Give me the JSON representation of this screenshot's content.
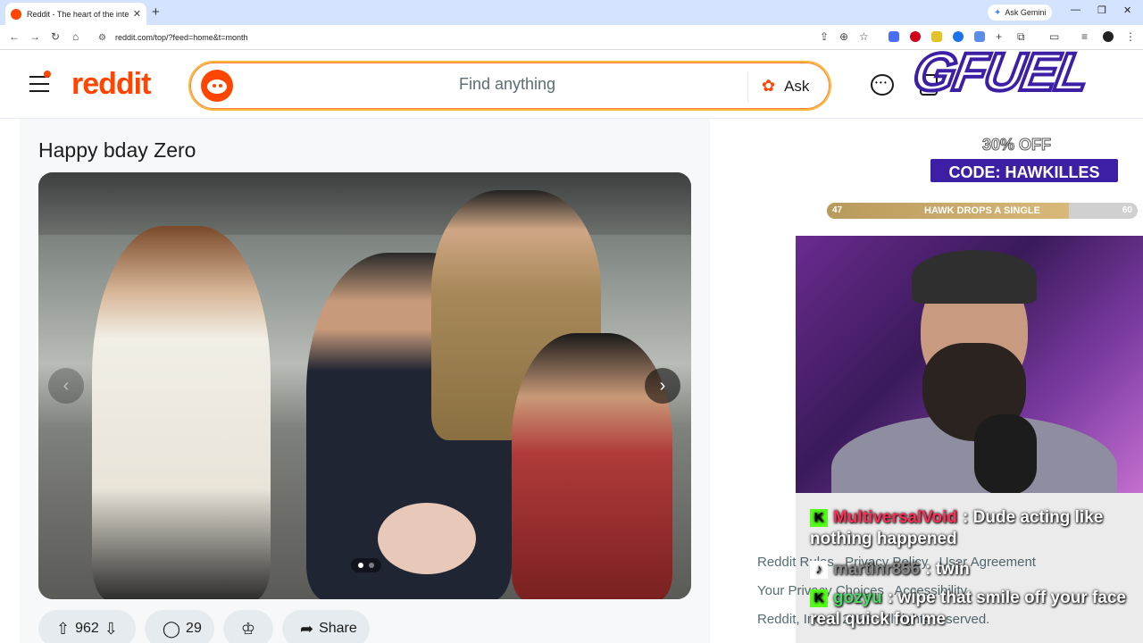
{
  "browser": {
    "tab_title": "Reddit - The heart of the internet",
    "new_tab": "+",
    "gemini_label": "Ask Gemini",
    "url": "reddit.com/top/?feed=home&t=month"
  },
  "header": {
    "logo": "reddit",
    "search_placeholder": "Find anything",
    "ask_label": "Ask"
  },
  "post": {
    "title": "Happy bday Zero",
    "upvotes": "962",
    "comments": "29",
    "share_label": "Share",
    "carousel_pages": 2,
    "carousel_current": 1
  },
  "footer": {
    "links": [
      "Reddit Rules",
      "Privacy Policy",
      "User Agreement",
      "Your Privacy Choices",
      "Accessibility"
    ],
    "copyright": "Reddit, Inc. © 2026. All rights reserved."
  },
  "overlay": {
    "brand": "GFUEL",
    "discount": "30% OFF",
    "code": "CODE: HAWKILLES",
    "goal_label": "HAWK DROPS A SINGLE",
    "goal_current": "47",
    "goal_target": "60",
    "goal_fraction": 0.78,
    "chat": [
      {
        "user": "MultiversalVoid",
        "user_color": "#ff2d55",
        "text": ": Dude acting like nothing happened"
      },
      {
        "user": "martinr856",
        "user_color": "#888888",
        "text": ": twin"
      },
      {
        "user": "gozyu",
        "user_color": "#4cd964",
        "text": ": wipe that smile off your face real quick for me"
      }
    ]
  }
}
